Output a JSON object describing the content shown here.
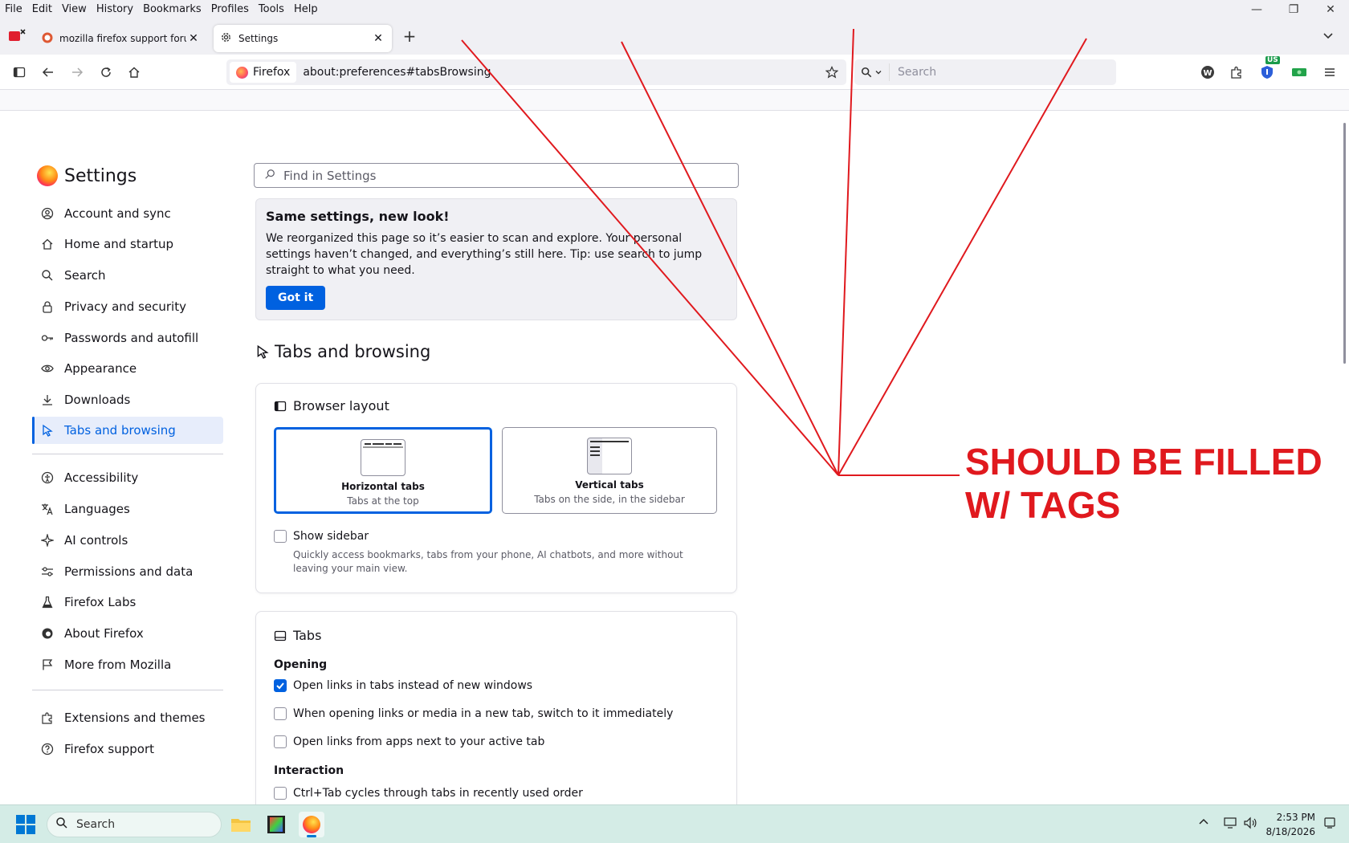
{
  "menubar": {
    "items": [
      "File",
      "Edit",
      "View",
      "History",
      "Bookmarks",
      "Profiles",
      "Tools",
      "Help"
    ]
  },
  "tabs": [
    {
      "title": "mozilla firefox support forum at",
      "icon": "duckduckgo-icon",
      "active": false
    },
    {
      "title": "Settings",
      "icon": "gear-icon",
      "active": true
    }
  ],
  "navbar": {
    "identity_label": "Firefox",
    "url": "about:preferences#tabsBrowsing",
    "search_placeholder": "Search",
    "extension_badge": "US"
  },
  "settings": {
    "title": "Settings",
    "find_placeholder": "Find in Settings",
    "nav": [
      {
        "label": "Account and sync",
        "icon": "account-icon"
      },
      {
        "label": "Home and startup",
        "icon": "home-icon"
      },
      {
        "label": "Search",
        "icon": "search-icon"
      },
      {
        "label": "Privacy and security",
        "icon": "lock-icon"
      },
      {
        "label": "Passwords and autofill",
        "icon": "key-icon"
      },
      {
        "label": "Appearance",
        "icon": "eye-icon"
      },
      {
        "label": "Downloads",
        "icon": "download-icon"
      },
      {
        "label": "Tabs and browsing",
        "icon": "cursor-icon",
        "selected": true
      },
      {
        "label": "Accessibility",
        "icon": "accessibility-icon"
      },
      {
        "label": "Languages",
        "icon": "translate-icon"
      },
      {
        "label": "AI controls",
        "icon": "sparkle-icon"
      },
      {
        "label": "Permissions and data",
        "icon": "sliders-icon"
      },
      {
        "label": "Firefox Labs",
        "icon": "flask-icon"
      },
      {
        "label": "About Firefox",
        "icon": "firefox-icon"
      },
      {
        "label": "More from Mozilla",
        "icon": "mozilla-icon"
      }
    ],
    "footer_nav": [
      {
        "label": "Extensions and themes",
        "icon": "puzzle-icon"
      },
      {
        "label": "Firefox support",
        "icon": "help-icon"
      }
    ],
    "notice": {
      "title": "Same settings, new look!",
      "body": "We reorganized this page so it’s easier to scan and explore. Your personal settings haven’t changed, and everything’s still here. Tip: use search to jump straight to what you need.",
      "button": "Got it"
    },
    "section_title": "Tabs and browsing",
    "browser_layout": {
      "title": "Browser layout",
      "options": [
        {
          "name": "Horizontal tabs",
          "desc": "Tabs at the top",
          "selected": true
        },
        {
          "name": "Vertical tabs",
          "desc": "Tabs on the side, in the sidebar",
          "selected": false
        }
      ],
      "show_sidebar": {
        "label": "Show sidebar",
        "checked": false,
        "desc": "Quickly access bookmarks, tabs from your phone, AI chatbots, and more without leaving your main view."
      }
    },
    "tabs_card": {
      "title": "Tabs",
      "opening_heading": "Opening",
      "opening": [
        {
          "label": "Open links in tabs instead of new windows",
          "checked": true
        },
        {
          "label": "When opening links or media in a new tab, switch to it immediately",
          "checked": false
        },
        {
          "label": "Open links from apps next to your active tab",
          "checked": false
        }
      ],
      "interaction_heading": "Interaction",
      "interaction": [
        {
          "label": "Ctrl+Tab cycles through tabs in recently used order",
          "checked": false
        }
      ]
    }
  },
  "annotation": {
    "line1": "SHOULD BE FILLED",
    "line2": "W/ TAGS",
    "color": "#e0191e"
  },
  "taskbar": {
    "search_placeholder": "Search",
    "time": "2:53 PM",
    "date": "8/18/2026"
  },
  "colors": {
    "accent": "#0061e0",
    "chrome_bg": "#f0f0f4",
    "taskbar_bg": "#d4ece6"
  }
}
